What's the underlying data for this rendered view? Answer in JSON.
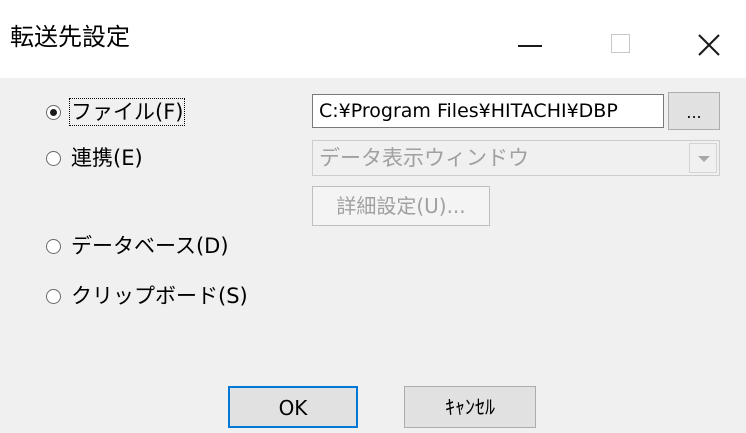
{
  "window": {
    "title": "転送先設定"
  },
  "options": [
    {
      "label": "ファイル(F)",
      "checked": true
    },
    {
      "label": "連携(E)",
      "checked": false
    },
    {
      "label": "データベース(D)",
      "checked": false
    },
    {
      "label": "クリップボード(S)",
      "checked": false
    }
  ],
  "file": {
    "path_value": "C:¥Program Files¥HITACHI¥DBP",
    "browse_label": "..."
  },
  "link": {
    "combo_value": "データ表示ウィンドウ",
    "detail_label": "詳細設定(U)..."
  },
  "buttons": {
    "ok_label": "OK",
    "cancel_label": "ｷｬﾝｾﾙ"
  },
  "colors": {
    "accent": "#0078d7",
    "disabled_text": "#a0a0a0"
  }
}
